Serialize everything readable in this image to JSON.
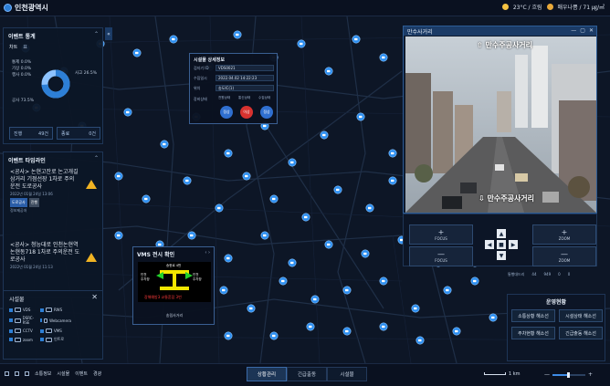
{
  "app": {
    "title": "인천광역시"
  },
  "weather": {
    "temp": "23°C / 흐림",
    "dust": "매우나쁨 / 71 ㎍/㎥"
  },
  "event_stats": {
    "title": "이벤트 통계",
    "tabs": [
      "차트",
      "표"
    ],
    "items": [
      {
        "label": "통제",
        "value": "0.0%"
      },
      {
        "label": "기상",
        "value": "0.0%"
      },
      {
        "label": "행사",
        "value": "0.0%"
      },
      {
        "label": "공사",
        "value": "73.5%"
      }
    ],
    "accident_label": "사고",
    "accident_value": "26.5%",
    "donut": {
      "construction": 73.5,
      "accident": 26.5
    },
    "progress_label": "진행",
    "progress_value": "49건",
    "done_label": "종료",
    "done_value": "0건"
  },
  "timeline": {
    "title": "이벤트 타임라인",
    "items": [
      {
        "text1": "<공사> 논현고잔로 논고개길",
        "text2": "삼거리 기점선장 1차로 주의",
        "text3": "운전 도로공사",
        "date": "2022년 01월 24일 13:06",
        "tag1": "도로공사",
        "tag2": "진행",
        "more": "정보제공처"
      },
      {
        "text1": "<공사> 청능대로 인천논현역",
        "text2": "논현동718 1차로 주의운전 도",
        "text3": "로공사",
        "date": "2022년 01월 24일 11:13",
        "tag1": "도로공사",
        "tag2": "진행",
        "more": "정보제공처"
      }
    ]
  },
  "facility_legend": {
    "title": "시설물",
    "close": "✕",
    "items": [
      "VDS",
      "RWS",
      "DSRC-RSE",
      "Webcamera",
      "CCTV",
      "VMS",
      "zoom",
      "인트로"
    ]
  },
  "facility_popup": {
    "title": "시설물 상세정보",
    "rows": [
      {
        "label": "검지기 ID",
        "value": "VDS0021"
      },
      {
        "label": "수집일시",
        "value": "2022.04.02 14:22:23"
      },
      {
        "label": "위치",
        "value": "송도IC(1)"
      },
      {
        "label": "장비상태",
        "value": ""
      }
    ],
    "status_labels": [
      "전원상태",
      "통신상태",
      "수집상태"
    ],
    "status_values": [
      "정상",
      "이상",
      "정상"
    ]
  },
  "cctv": {
    "title": "만수사거리",
    "controls": [
      "—",
      "▢",
      "✕"
    ],
    "top_label": "만수주공사거리",
    "bottom_label": "만수주공사거리"
  },
  "ptz": {
    "focus_plus": "FOCUS",
    "focus_minus": "FOCUS",
    "zoom_plus": "ZOOM",
    "zoom_minus": "ZOOM",
    "plus": "+",
    "minus": "—",
    "arrows": [
      "▲",
      "◀",
      "■",
      "▶",
      "▼"
    ]
  },
  "traffic_row": {
    "label": "통행대드리",
    "values": [
      "44",
      "949",
      "0",
      "0"
    ]
  },
  "operations": {
    "title": "운영현황",
    "buttons": [
      "소통상황 해소선",
      "시설상태 해소선",
      "주차현황 해소선",
      "긴급출동 해소선"
    ]
  },
  "vms": {
    "title": "VMS 전시 확인",
    "nav": "‹ ›",
    "board_top": "송현로 4번",
    "board_left": "인천\n주차장",
    "board_right": "인천\n주차장",
    "board_bottom": "장해예방3 교통혼잡 3번",
    "caption": "송림사거리"
  },
  "bottom": {
    "left_items": [
      "",
      "",
      "",
      "소통정보",
      "시설물",
      "이벤트",
      "경광"
    ],
    "tabs": [
      "상황관리",
      "긴급출동",
      "시설물"
    ],
    "scale": "1 km",
    "zoom_minus": "—",
    "zoom_plus": "+",
    "zoom_level": 0.45
  },
  "colors": {
    "accent": "#2d7fd6",
    "panel": "#0c1626",
    "warning": "#f0b323",
    "ok": "#2f6fd0",
    "error": "#d8322f"
  }
}
